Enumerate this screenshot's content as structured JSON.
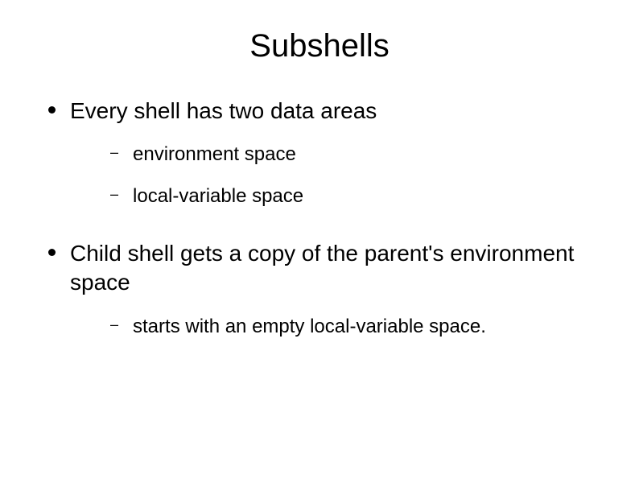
{
  "slide": {
    "title": "Subshells",
    "bullets": [
      {
        "text": "Every shell has two data areas",
        "children": [
          {
            "text": "environment space"
          },
          {
            "text": "local-variable space"
          }
        ]
      },
      {
        "text": "Child shell gets a copy of the parent's environment space",
        "children": [
          {
            "text": "starts with an empty local-variable space."
          }
        ]
      }
    ]
  }
}
